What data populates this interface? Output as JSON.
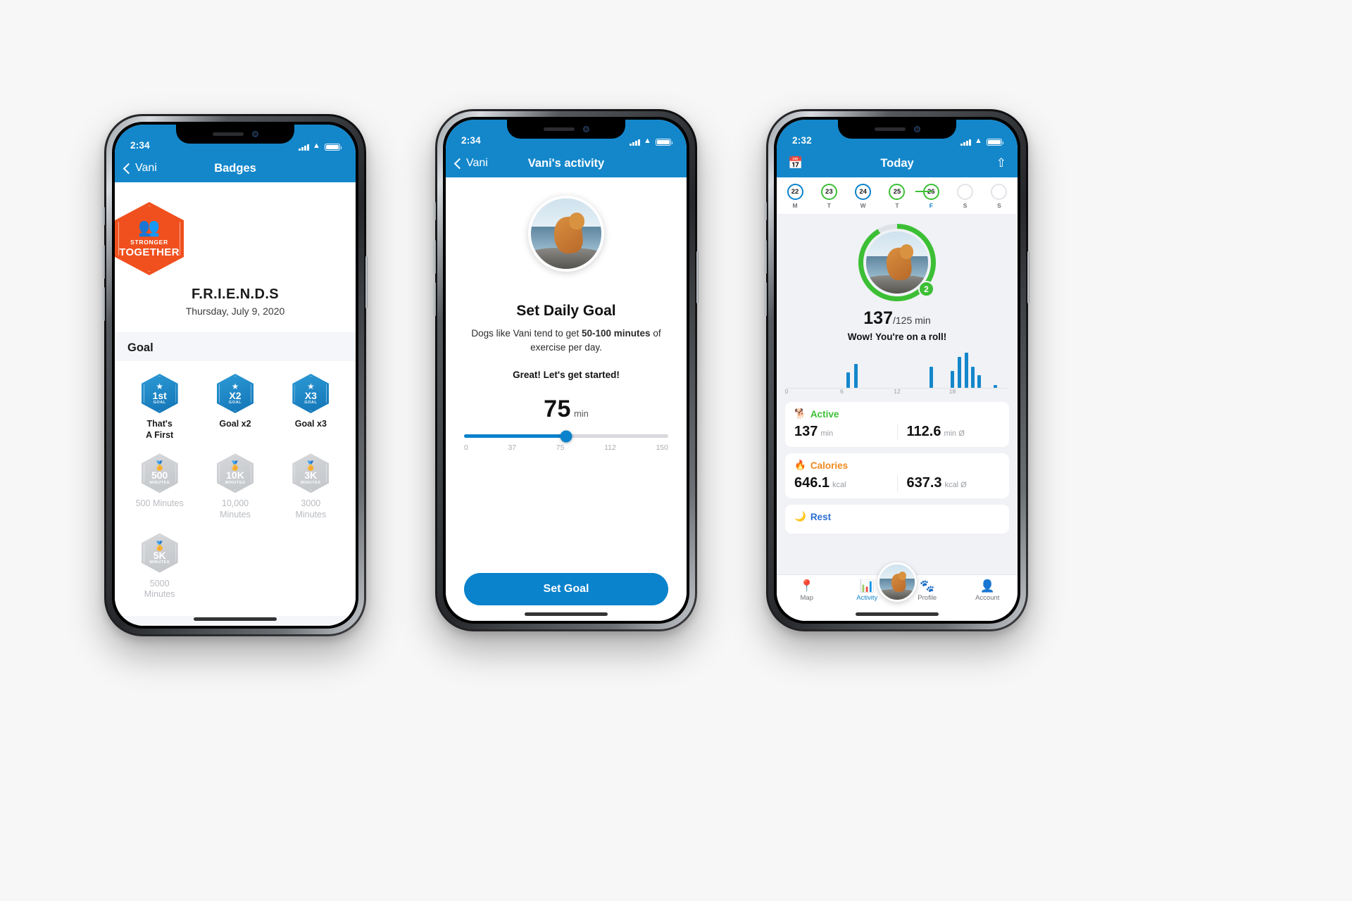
{
  "theme": {
    "brand": "#1487cb",
    "accent_green": "#3cbf35",
    "accent_orange": "#f08a1e",
    "badge_orange": "#f0501e"
  },
  "phone1": {
    "status": {
      "time": "2:34"
    },
    "nav": {
      "back_label": "Vani",
      "title": "Badges"
    },
    "hero_badge": {
      "icon": "people-icon",
      "line1": "STRONGER",
      "line2": "TOGETHER",
      "name": "F.R.I.E.N.D.S",
      "date": "Thursday, July 9, 2020"
    },
    "section_title": "Goal",
    "badges": [
      {
        "big": "1st",
        "sub": "GOAL",
        "icon": "star-icon",
        "label": "That's\nA First",
        "locked": false
      },
      {
        "big": "X2",
        "sub": "GOAL",
        "icon": "star-icon",
        "label": "Goal x2",
        "locked": false
      },
      {
        "big": "X3",
        "sub": "GOAL",
        "icon": "star-icon",
        "label": "Goal x3",
        "locked": false
      },
      {
        "big": "500",
        "sub": "MINUTES",
        "icon": "medal-icon",
        "label": "500 Minutes",
        "locked": true
      },
      {
        "big": "10K",
        "sub": "MINUTES",
        "icon": "medal-icon",
        "label": "10,000\nMinutes",
        "locked": true
      },
      {
        "big": "3K",
        "sub": "MINUTES",
        "icon": "medal-icon",
        "label": "3000\nMinutes",
        "locked": true
      },
      {
        "big": "5K",
        "sub": "MINUTES",
        "icon": "medal-icon",
        "label": "5000\nMinutes",
        "locked": true
      }
    ]
  },
  "phone2": {
    "status": {
      "time": "2:34"
    },
    "nav": {
      "back_label": "Vani",
      "title": "Vani's activity"
    },
    "avatar": "dog-photo",
    "title": "Set Daily Goal",
    "desc_pre": "Dogs like Vani tend to get ",
    "desc_bold": "50-100 minutes",
    "desc_post": " of exercise per day.",
    "cta_text": "Great! Let's get started!",
    "value": "75",
    "unit": "min",
    "slider": {
      "min": 0,
      "max": 150,
      "value": 75,
      "ticks": [
        "0",
        "37",
        "75",
        "112",
        "150"
      ]
    },
    "button_label": "Set Goal"
  },
  "phone3": {
    "status": {
      "time": "2:32"
    },
    "nav": {
      "title": "Today",
      "left_icon": "calendar-icon",
      "right_icon": "share-icon"
    },
    "week": [
      {
        "day": "22",
        "letter": "M",
        "state": "blue"
      },
      {
        "day": "23",
        "letter": "T",
        "state": "green"
      },
      {
        "day": "24",
        "letter": "W",
        "state": "blue"
      },
      {
        "day": "25",
        "letter": "T",
        "state": "green"
      },
      {
        "day": "26",
        "letter": "F",
        "state": "green",
        "selected": true
      },
      {
        "day": "",
        "letter": "S",
        "state": "empty"
      },
      {
        "day": "",
        "letter": "S",
        "state": "empty"
      }
    ],
    "progress": {
      "value": "137",
      "goal": "/125 min",
      "badge": "2",
      "message": "Wow! You're on a roll!"
    },
    "chart": {
      "type": "bar",
      "xlabel": "hour",
      "ticks": [
        "0",
        "6",
        "12",
        "18"
      ],
      "bars": [
        {
          "hour": 6.5,
          "value": 22
        },
        {
          "hour": 7.3,
          "value": 34
        },
        {
          "hour": 15.5,
          "value": 30
        },
        {
          "hour": 17.8,
          "value": 24
        },
        {
          "hour": 18.6,
          "value": 44
        },
        {
          "hour": 19.3,
          "value": 50
        },
        {
          "hour": 20.0,
          "value": 30
        },
        {
          "hour": 20.7,
          "value": 18
        },
        {
          "hour": 22.5,
          "value": 4
        }
      ]
    },
    "stats": [
      {
        "icon": "dog-icon",
        "title": "Active",
        "color": "c-green",
        "left_value": "137",
        "left_unit": "min",
        "right_value": "112.6",
        "right_unit": "min Ø"
      },
      {
        "icon": "flame-icon",
        "title": "Calories",
        "color": "c-orange",
        "left_value": "646.1",
        "left_unit": "kcal",
        "right_value": "637.3",
        "right_unit": "kcal Ø"
      },
      {
        "icon": "moon-icon",
        "title": "Rest",
        "color": "c-blue",
        "left_value": "",
        "left_unit": "",
        "right_value": "",
        "right_unit": ""
      }
    ],
    "tabs": [
      {
        "icon": "map-pin-icon",
        "label": "Map",
        "active": false
      },
      {
        "icon": "activity-icon",
        "label": "Activity",
        "active": true
      },
      {
        "icon": "paw-icon",
        "label": "Profile",
        "active": false
      },
      {
        "icon": "person-icon",
        "label": "Account",
        "active": false
      }
    ]
  }
}
